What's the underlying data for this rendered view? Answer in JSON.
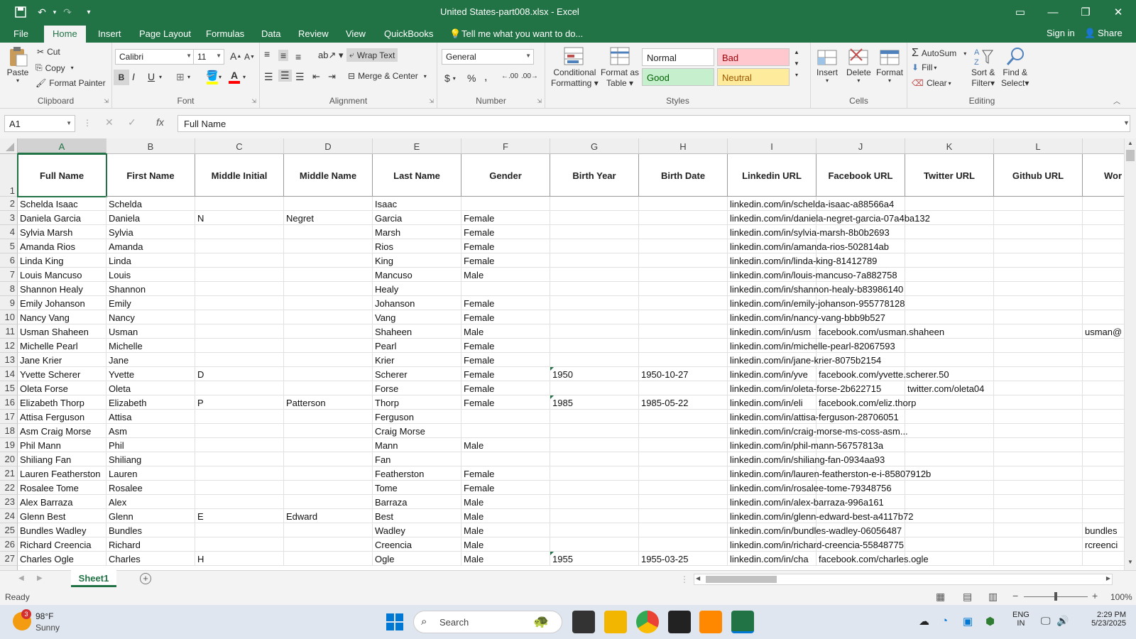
{
  "window": {
    "title": "United States-part008.xlsx - Excel",
    "controls": {
      "ribbon_display": "▭",
      "minimize": "—",
      "restore": "❐",
      "close": "✕"
    }
  },
  "quick_access": {
    "save": "💾",
    "undo": "↶",
    "redo": "↷",
    "customize": "▾"
  },
  "menu": {
    "tabs": [
      "File",
      "Home",
      "Insert",
      "Page Layout",
      "Formulas",
      "Data",
      "Review",
      "View",
      "QuickBooks"
    ],
    "active_tab": "Home",
    "tell_me": "Tell me what you want to do...",
    "sign_in": "Sign in",
    "share": "Share"
  },
  "ribbon": {
    "clipboard": {
      "paste": "Paste",
      "cut": "Cut",
      "copy": "Copy",
      "format_painter": "Format Painter",
      "label": "Clipboard"
    },
    "font": {
      "name": "Calibri",
      "size": "11",
      "bold": "B",
      "italic": "I",
      "underline": "U",
      "label": "Font"
    },
    "alignment": {
      "wrap_text": "Wrap Text",
      "merge_center": "Merge & Center",
      "label": "Alignment"
    },
    "number": {
      "format": "General",
      "currency": "$",
      "percent": "%",
      "comma": ",",
      "label": "Number"
    },
    "styles": {
      "conditional": "Conditional",
      "conditional2": "Formatting",
      "format_table": "Format as",
      "format_table2": "Table",
      "normal": "Normal",
      "bad": "Bad",
      "good": "Good",
      "neutral": "Neutral",
      "label": "Styles"
    },
    "cells": {
      "insert": "Insert",
      "delete": "Delete",
      "format": "Format",
      "label": "Cells"
    },
    "editing": {
      "autosum": "AutoSum",
      "fill": "Fill",
      "clear": "Clear",
      "sort": "Sort &",
      "sort2": "Filter",
      "find": "Find &",
      "find2": "Select",
      "label": "Editing"
    }
  },
  "formula_bar": {
    "name_box": "A1",
    "fx": "fx",
    "content": "Full Name"
  },
  "columns": [
    "A",
    "B",
    "C",
    "D",
    "E",
    "F",
    "G",
    "H",
    "I",
    "J",
    "K",
    "L"
  ],
  "headers": [
    "Full Name",
    "First Name",
    "Middle Initial",
    "Middle Name",
    "Last Name",
    "Gender",
    "Birth Year",
    "Birth Date",
    "Linkedin URL",
    "Facebook URL",
    "Twitter URL",
    "Github URL",
    "Wor"
  ],
  "rows": [
    {
      "n": "2",
      "full": "Schelda Isaac",
      "first": "Schelda",
      "mi": "",
      "mid": "",
      "last": "Isaac",
      "gender": "",
      "year": "",
      "date": "",
      "li": "linkedin.com/in/schelda-isaac-a88566a4",
      "fb": "",
      "tw": "",
      "wo": ""
    },
    {
      "n": "3",
      "full": "Daniela Garcia",
      "first": "Daniela",
      "mi": "N",
      "mid": "Negret",
      "last": "Garcia",
      "gender": "Female",
      "year": "",
      "date": "",
      "li": "linkedin.com/in/daniela-negret-garcia-07a4ba132",
      "fb": "",
      "tw": "",
      "wo": ""
    },
    {
      "n": "4",
      "full": "Sylvia Marsh",
      "first": "Sylvia",
      "mi": "",
      "mid": "",
      "last": "Marsh",
      "gender": "Female",
      "year": "",
      "date": "",
      "li": "linkedin.com/in/sylvia-marsh-8b0b2693",
      "fb": "",
      "tw": "",
      "wo": ""
    },
    {
      "n": "5",
      "full": "Amanda Rios",
      "first": "Amanda",
      "mi": "",
      "mid": "",
      "last": "Rios",
      "gender": "Female",
      "year": "",
      "date": "",
      "li": "linkedin.com/in/amanda-rios-502814ab",
      "fb": "",
      "tw": "",
      "wo": ""
    },
    {
      "n": "6",
      "full": "Linda King",
      "first": "Linda",
      "mi": "",
      "mid": "",
      "last": "King",
      "gender": "Female",
      "year": "",
      "date": "",
      "li": "linkedin.com/in/linda-king-81412789",
      "fb": "",
      "tw": "",
      "wo": ""
    },
    {
      "n": "7",
      "full": "Louis Mancuso",
      "first": "Louis",
      "mi": "",
      "mid": "",
      "last": "Mancuso",
      "gender": "Male",
      "year": "",
      "date": "",
      "li": "linkedin.com/in/louis-mancuso-7a882758",
      "fb": "",
      "tw": "",
      "wo": ""
    },
    {
      "n": "8",
      "full": "Shannon Healy",
      "first": "Shannon",
      "mi": "",
      "mid": "",
      "last": "Healy",
      "gender": "",
      "year": "",
      "date": "",
      "li": "linkedin.com/in/shannon-healy-b83986140",
      "fb": "",
      "tw": "",
      "wo": ""
    },
    {
      "n": "9",
      "full": "Emily Johanson",
      "first": "Emily",
      "mi": "",
      "mid": "",
      "last": "Johanson",
      "gender": "Female",
      "year": "",
      "date": "",
      "li": "linkedin.com/in/emily-johanson-955778128",
      "fb": "",
      "tw": "",
      "wo": ""
    },
    {
      "n": "10",
      "full": "Nancy Vang",
      "first": "Nancy",
      "mi": "",
      "mid": "",
      "last": "Vang",
      "gender": "Female",
      "year": "",
      "date": "",
      "li": "linkedin.com/in/nancy-vang-bbb9b527",
      "fb": "",
      "tw": "",
      "wo": ""
    },
    {
      "n": "11",
      "full": "Usman Shaheen",
      "first": "Usman",
      "mi": "",
      "mid": "",
      "last": "Shaheen",
      "gender": "Male",
      "year": "",
      "date": "",
      "li": "linkedin.com/in/usm",
      "fb": "facebook.com/usman.shaheen",
      "tw": "",
      "wo": "usman@"
    },
    {
      "n": "12",
      "full": "Michelle Pearl",
      "first": "Michelle",
      "mi": "",
      "mid": "",
      "last": "Pearl",
      "gender": "Female",
      "year": "",
      "date": "",
      "li": "linkedin.com/in/michelle-pearl-82067593",
      "fb": "",
      "tw": "",
      "wo": ""
    },
    {
      "n": "13",
      "full": "Jane Krier",
      "first": "Jane",
      "mi": "",
      "mid": "",
      "last": "Krier",
      "gender": "Female",
      "year": "",
      "date": "",
      "li": "linkedin.com/in/jane-krier-8075b2154",
      "fb": "",
      "tw": "",
      "wo": ""
    },
    {
      "n": "14",
      "full": "Yvette Scherer",
      "first": "Yvette",
      "mi": "D",
      "mid": "",
      "last": "Scherer",
      "gender": "Female",
      "year": "1950",
      "date": "1950-10-27",
      "li": "linkedin.com/in/yve",
      "fb": "facebook.com/yvette.scherer.50",
      "tw": "",
      "wo": ""
    },
    {
      "n": "15",
      "full": "Oleta Forse",
      "first": "Oleta",
      "mi": "",
      "mid": "",
      "last": "Forse",
      "gender": "Female",
      "year": "",
      "date": "",
      "li": "linkedin.com/in/oleta-forse-2b622715",
      "fb": "",
      "tw": "twitter.com/oleta04",
      "wo": ""
    },
    {
      "n": "16",
      "full": "Elizabeth Thorp",
      "first": "Elizabeth",
      "mi": "P",
      "mid": "Patterson",
      "last": "Thorp",
      "gender": "Female",
      "year": "1985",
      "date": "1985-05-22",
      "li": "linkedin.com/in/eli",
      "fb": "facebook.com/eliz.thorp",
      "tw": "",
      "wo": ""
    },
    {
      "n": "17",
      "full": "Attisa Ferguson",
      "first": "Attisa",
      "mi": "",
      "mid": "",
      "last": "Ferguson",
      "gender": "",
      "year": "",
      "date": "",
      "li": "linkedin.com/in/attisa-ferguson-28706051",
      "fb": "",
      "tw": "",
      "wo": ""
    },
    {
      "n": "18",
      "full": "Asm Craig Morse",
      "first": "Asm",
      "mi": "",
      "mid": "",
      "last": "Craig Morse",
      "gender": "",
      "year": "",
      "date": "",
      "li": "linkedin.com/in/craig-morse-ms-coss-asm...",
      "fb": "",
      "tw": "",
      "wo": ""
    },
    {
      "n": "19",
      "full": "Phil Mann",
      "first": "Phil",
      "mi": "",
      "mid": "",
      "last": "Mann",
      "gender": "Male",
      "year": "",
      "date": "",
      "li": "linkedin.com/in/phil-mann-56757813a",
      "fb": "",
      "tw": "",
      "wo": ""
    },
    {
      "n": "20",
      "full": "Shiliang Fan",
      "first": "Shiliang",
      "mi": "",
      "mid": "",
      "last": "Fan",
      "gender": "",
      "year": "",
      "date": "",
      "li": "linkedin.com/in/shiliang-fan-0934aa93",
      "fb": "",
      "tw": "",
      "wo": ""
    },
    {
      "n": "21",
      "full": "Lauren Featherston",
      "first": "Lauren",
      "mi": "",
      "mid": "",
      "last": "Featherston",
      "gender": "Female",
      "year": "",
      "date": "",
      "li": "linkedin.com/in/lauren-featherston-e-i-85807912b",
      "fb": "",
      "tw": "",
      "wo": ""
    },
    {
      "n": "22",
      "full": "Rosalee Tome",
      "first": "Rosalee",
      "mi": "",
      "mid": "",
      "last": "Tome",
      "gender": "Female",
      "year": "",
      "date": "",
      "li": "linkedin.com/in/rosalee-tome-79348756",
      "fb": "",
      "tw": "",
      "wo": ""
    },
    {
      "n": "23",
      "full": "Alex Barraza",
      "first": "Alex",
      "mi": "",
      "mid": "",
      "last": "Barraza",
      "gender": "Male",
      "year": "",
      "date": "",
      "li": "linkedin.com/in/alex-barraza-996a161",
      "fb": "",
      "tw": "",
      "wo": ""
    },
    {
      "n": "24",
      "full": "Glenn Best",
      "first": "Glenn",
      "mi": "E",
      "mid": "Edward",
      "last": "Best",
      "gender": "Male",
      "year": "",
      "date": "",
      "li": "linkedin.com/in/glenn-edward-best-a4117b72",
      "fb": "",
      "tw": "",
      "wo": ""
    },
    {
      "n": "25",
      "full": "Bundles Wadley",
      "first": "Bundles",
      "mi": "",
      "mid": "",
      "last": "Wadley",
      "gender": "Male",
      "year": "",
      "date": "",
      "li": "linkedin.com/in/bundles-wadley-06056487",
      "fb": "",
      "tw": "",
      "wo": "bundles"
    },
    {
      "n": "26",
      "full": "Richard Creencia",
      "first": "Richard",
      "mi": "",
      "mid": "",
      "last": "Creencia",
      "gender": "Male",
      "year": "",
      "date": "",
      "li": "linkedin.com/in/richard-creencia-55848775",
      "fb": "",
      "tw": "",
      "wo": "rcreenci"
    },
    {
      "n": "27",
      "full": "Charles Ogle",
      "first": "Charles",
      "mi": "H",
      "mid": "",
      "last": "Ogle",
      "gender": "Male",
      "year": "1955",
      "date": "1955-03-25",
      "li": "linkedin.com/in/cha",
      "fb": "facebook.com/charles.ogle",
      "tw": "",
      "wo": ""
    }
  ],
  "sheet": {
    "tab": "Sheet1",
    "add": "+"
  },
  "status": {
    "ready": "Ready",
    "zoom": "100%"
  },
  "taskbar": {
    "weather_temp": "98°F",
    "weather_desc": "Sunny",
    "weather_badge": "3",
    "search": "Search",
    "lang1": "ENG",
    "lang2": "IN",
    "time": "2:29 PM",
    "date": "5/23/2025"
  },
  "colors": {
    "excel_green": "#217346",
    "bad_bg": "#ffc7ce",
    "good_bg": "#c6efce",
    "neutral_bg": "#ffeb9c"
  }
}
